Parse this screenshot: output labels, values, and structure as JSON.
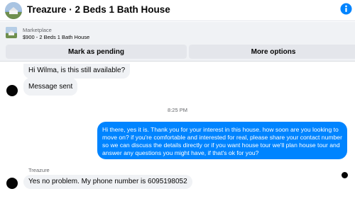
{
  "header": {
    "title": "Treazure · 2 Beds 1 Bath House",
    "info_icon": "info-circle-icon",
    "accent": "#0084ff"
  },
  "listing": {
    "source": "Marketplace",
    "detail": "$900 - 2 Beds 1 Bath House"
  },
  "actions": {
    "mark_pending": "Mark as pending",
    "more_options": "More options"
  },
  "messages": {
    "incoming_1": "Hi Wilma, is this still available?",
    "incoming_2": "Message sent",
    "timestamp": "8:25 PM",
    "outgoing_1": "Hi there, yes it is. Thank you for your interest in this house. how soon are you looking to move on? if you're comfortable and interested for real, please share your contact number so we can discuss the details directly or if you want house tour we'll plan house tour and answer any questions you might have, if that's ok for you?",
    "sender_name": "Treazure",
    "incoming_3": "Yes no problem. My phone number is 6095198052"
  },
  "colors": {
    "outgoing_bubble": "#0084ff",
    "incoming_bubble": "#f0f2f5",
    "action_button": "#e4e6eb"
  }
}
